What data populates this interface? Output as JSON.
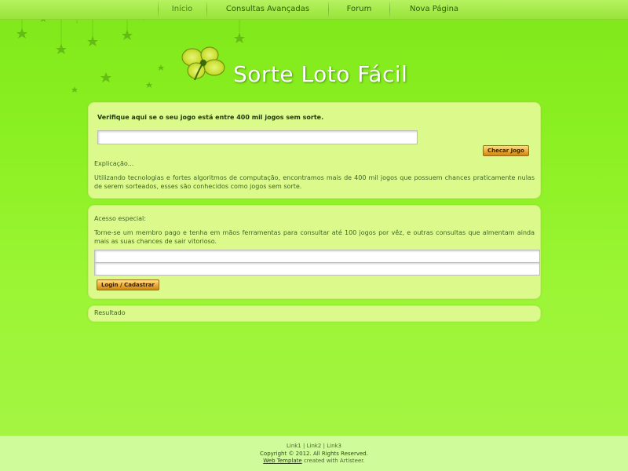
{
  "menu": {
    "items": [
      {
        "label": "Início",
        "active": true
      },
      {
        "label": "Consultas Avançadas",
        "active": false
      },
      {
        "label": "Forum",
        "active": false
      },
      {
        "label": "Nova Página",
        "active": false
      }
    ]
  },
  "header": {
    "title": "Sorte Loto Fácil",
    "logo_icon": "four-leaf-clover-icon"
  },
  "check_panel": {
    "heading": "Verifique aqui se o seu jogo está entre 400 mil jogos sem sorte.",
    "input_value": "",
    "button_label": "Checar Jogo",
    "explanation_title": "Explicação...",
    "explanation_text": "Utilizando tecnologias e fortes algoritmos de computação, encontramos mais de 400 mil jogos que possuem chances praticamente nulas de serem sorteados, esses são conhecidos como jogos sem sorte."
  },
  "access_panel": {
    "title": "Acesso especial:",
    "text": "Torne-se um membro pago e tenha em mãos ferramentas para consultar até 100 jogos por vêz, e outras consultas que almentam ainda mais as suas chances de sair vitorioso.",
    "field1_value": "",
    "field2_value": "",
    "button_label": "Login / Cadastrar"
  },
  "result_panel": {
    "label": "Resultado"
  },
  "footer": {
    "links": [
      "Link1",
      "Link2",
      "Link3"
    ],
    "separator": "|",
    "copyright": "Copyright © 2012. All Rights Reserved.",
    "credit_link": "Web Template",
    "credit_text": "created with Artisteer."
  },
  "colors": {
    "background": "#8cf022",
    "panel": "#dcfa8c",
    "button": "#ecaa33",
    "footer": "#cffb9a"
  }
}
